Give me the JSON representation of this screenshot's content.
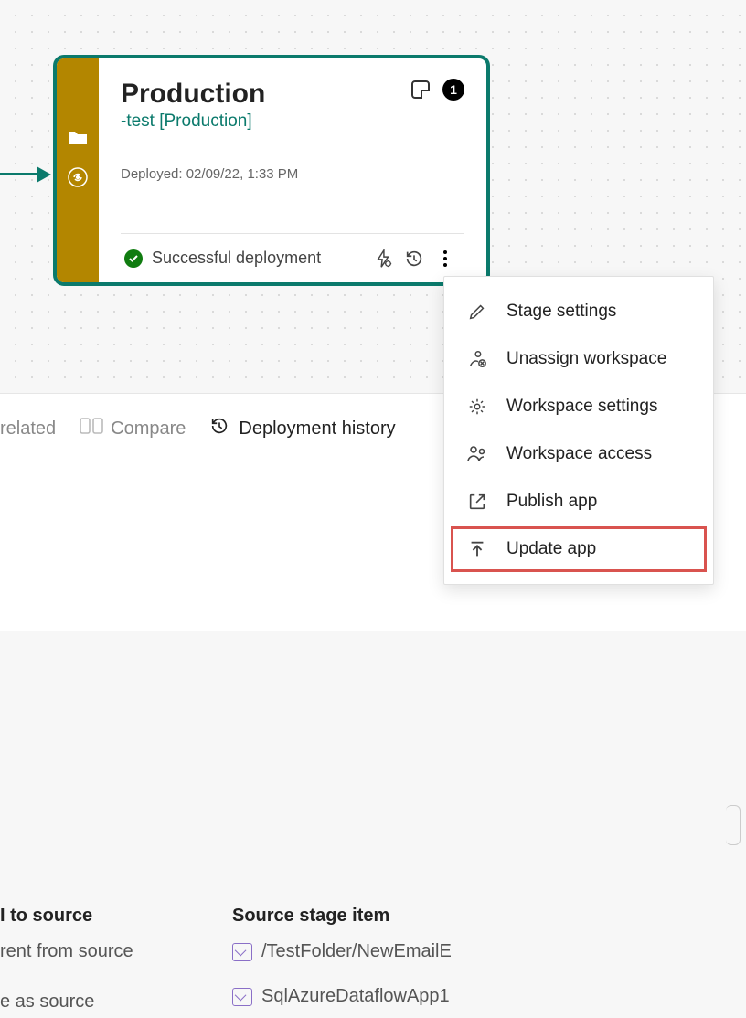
{
  "stage": {
    "title": "Production",
    "subtitle": "-test [Production]",
    "deployed_prefix": "Deployed:",
    "deployed_ts": "02/09/22, 1:33 PM",
    "status": "Successful deployment",
    "badge": "1"
  },
  "menu": {
    "items": [
      {
        "label": "Stage settings"
      },
      {
        "label": "Unassign workspace"
      },
      {
        "label": "Workspace settings"
      },
      {
        "label": "Workspace access"
      },
      {
        "label": "Publish app"
      },
      {
        "label": "Update app"
      }
    ]
  },
  "tabs": {
    "related": "related",
    "compare": "Compare",
    "history": "Deployment history"
  },
  "table": {
    "left_head": "I to source",
    "left_r1": "rent from source",
    "left_r2": "e as source",
    "right_head": "Source stage item",
    "right_r1": "/TestFolder/NewEmailE",
    "right_r2": "SqlAzureDataflowApp1"
  }
}
